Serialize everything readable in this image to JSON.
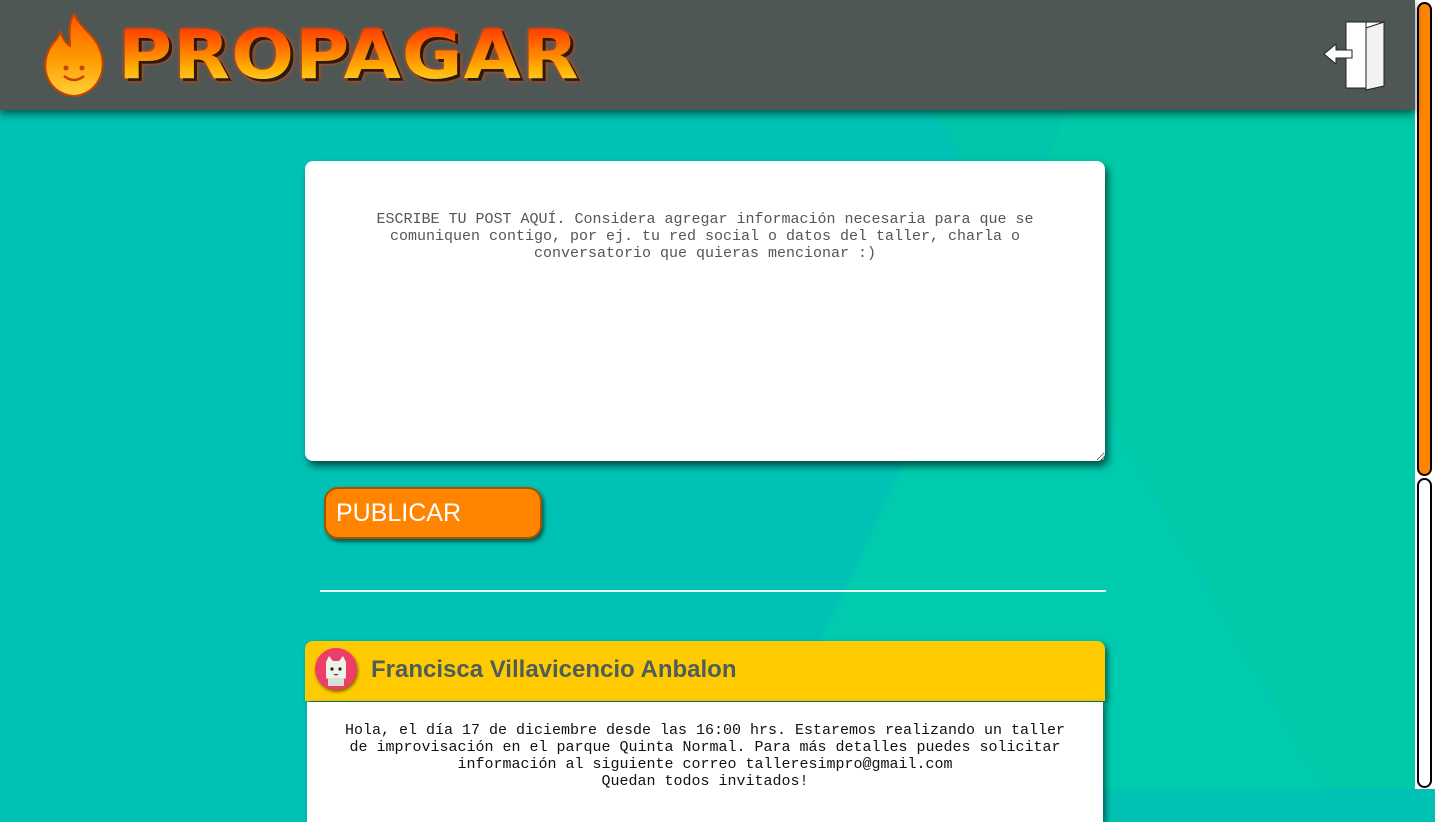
{
  "header": {
    "logo_text": "PROPAGAR",
    "logo_icon": "flame-icon",
    "logout_icon": "logout-door-icon"
  },
  "composer": {
    "placeholder": "ESCRIBE TU POST AQUÍ. Considera agregar información necesaria para que se comuniquen contigo, por ej. tu red social o datos del taller, charla o conversatorio que quieras mencionar :)",
    "value": "",
    "publish_label": "PUBLICAR"
  },
  "feed": {
    "posts": [
      {
        "author": "Francisca Villavicencio Anbalon",
        "avatar_icon": "cat-avatar-icon",
        "lines": [
          "Hola, el día 17 de diciembre desde las 16:00 hrs. Estaremos realizando un taller de improvisación en el parque Quinta Normal. Para más detalles puedes solicitar información al siguiente correo talleresimpro@gmail.com",
          "Quedan todos invitados!"
        ]
      }
    ]
  },
  "colors": {
    "background": "#00c2b4",
    "header": "#4f5754",
    "accent": "#ff8400",
    "post_header": "#ffcb00",
    "author_text": "#4f5d5a"
  }
}
